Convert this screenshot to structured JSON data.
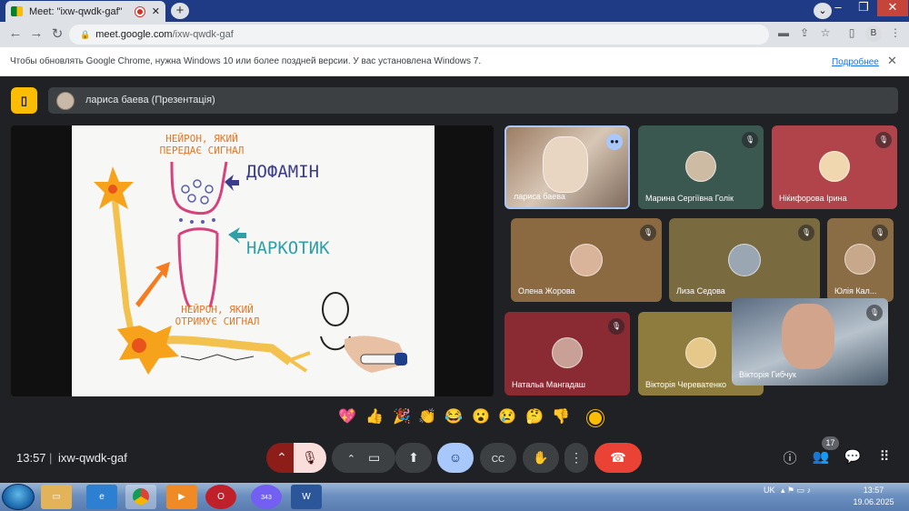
{
  "browser": {
    "tab_title": "Meet: \"ixw-qwdk-gaf\"",
    "new_tab": "+",
    "url_host": "meet.google.com",
    "url_path": "/ixw-qwdk-gaf",
    "profile_initial": "B",
    "infobar_text": "Чтобы обновлять Google Chrome, нужна Windows 10 или более поздней версии. У вас установлена Windows 7.",
    "infobar_link": "Подробнее"
  },
  "meet": {
    "presenter_label": "лариса баева (Презентація)",
    "clock": "13:57",
    "separator": "|",
    "meeting_code": "ixw-qwdk-gaf",
    "participants_count": "17",
    "slide": {
      "text_sender_line1": "НЕЙРОН, ЯКИЙ",
      "text_sender_line2": "ПЕРЕДАЄ СИГНАЛ",
      "text_dopamine": "ДОФАМІН",
      "text_drug": "НАРКОТИК",
      "text_receiver_line1": "НЕЙРОН, ЯКИЙ",
      "text_receiver_line2": "ОТРИМУЄ СИГНАЛ"
    },
    "tiles": [
      {
        "name": "лариса баева"
      },
      {
        "name": "Марина Сергіївна Голік"
      },
      {
        "name": "Ніќифорова Ірина"
      },
      {
        "name": "Олена Жорова"
      },
      {
        "name": "Лиза Седова"
      },
      {
        "name": "Юлія Кал..."
      },
      {
        "name": "Натальа Мангадаш"
      },
      {
        "name": "Вікторія Череватенко"
      },
      {
        "name": "Вікторія Гибчук"
      }
    ],
    "reactions": [
      "💖",
      "👍",
      "🎉",
      "👏",
      "😂",
      "😮",
      "😢",
      "🤔",
      "👎"
    ],
    "colors": {
      "end_call": "#ea4335",
      "active_button": "#a8c7fa",
      "mic_off": "#8c1d18",
      "accent_yellow": "#fbbc04"
    }
  },
  "taskbar": {
    "lang": "UK",
    "time": "13:57",
    "date": "19.06.2025",
    "viber_badge": "343"
  }
}
